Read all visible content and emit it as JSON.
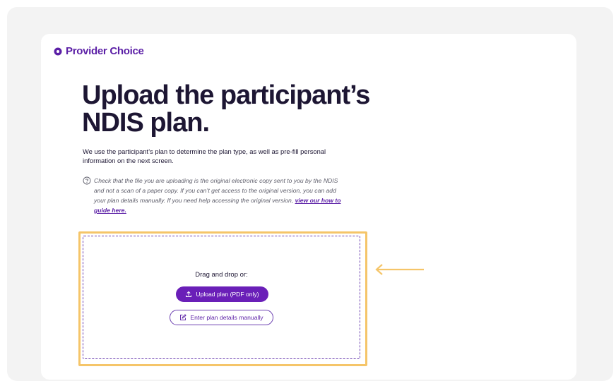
{
  "brand": {
    "name": "Provider Choice",
    "color": "#5b1fa6"
  },
  "heading": "Upload the participant’s NDIS plan.",
  "lead": "We use the participant’s plan to determine the plan type, as well as pre-fill personal information on the next screen.",
  "note": {
    "icon": "help-circle-icon",
    "text": "Check that the file you are uploading is the original electronic copy sent to you by the NDIS and not a scan of a paper copy. If you can’t get access to the original version, you can add your plan details manually. If you need help accessing the original version, ",
    "link_label": "view our how to guide here."
  },
  "upload": {
    "drag_text": "Drag and drop or:",
    "upload_button": "Upload plan (PDF only)",
    "upload_icon": "upload-icon",
    "manual_button": "Enter plan details manually",
    "manual_icon": "edit-icon"
  },
  "colors": {
    "accent": "#6a1fb8",
    "highlight": "#f5c569",
    "text": "#1d1633"
  }
}
